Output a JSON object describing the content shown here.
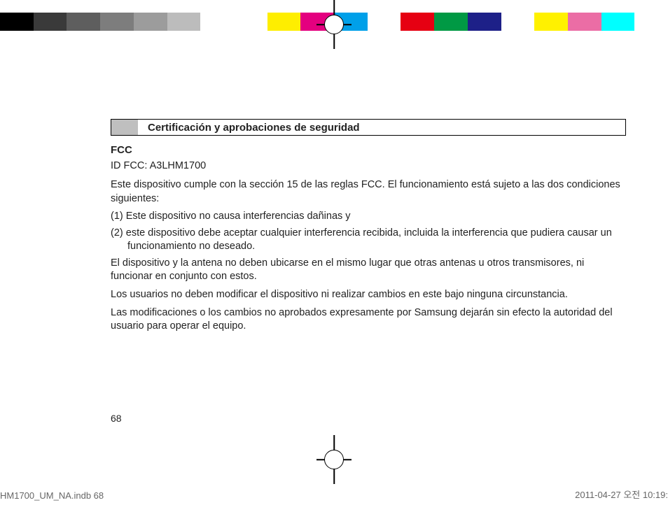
{
  "color_bar": [
    "#000000",
    "#3a3a3a",
    "#5e5e5e",
    "#7d7d7d",
    "#9c9c9c",
    "#bcbcbc",
    "#ffffff",
    "#ffffff",
    "#feee00",
    "#e4007f",
    "#00a0e9",
    "#ffffff",
    "#e60012",
    "#009944",
    "#1d2088",
    "#ffffff",
    "#fff100",
    "#eb6da5",
    "#00ffff",
    "#ffffff"
  ],
  "section_title": "Certificación y aprobaciones de seguridad",
  "fcc": {
    "heading": "FCC",
    "id_line": "ID FCC: A3LHM1700",
    "intro": "Este dispositivo cumple con la sección 15 de las reglas FCC. El funcionamiento está sujeto a las dos condiciones siguientes:",
    "item1": "(1) Este dispositivo no causa interferencias dañinas y",
    "item2": "(2) este dispositivo debe aceptar cualquier interferencia recibida, incluida la interferencia que pudiera causar un funcionamiento no deseado.",
    "para1": "El dispositivo y la antena no deben ubicarse en el mismo lugar que otras antenas u otros transmisores, ni funcionar en conjunto con estos.",
    "para2": "Los usuarios no deben modificar el dispositivo ni realizar cambios en este bajo ninguna circunstancia.",
    "para3": "Las modificaciones o los cambios no aprobados expresamente por Samsung dejarán sin efecto la autoridad del usuario para operar el equipo."
  },
  "page_number": "68",
  "footer": {
    "left": "HM1700_UM_NA.indb   68",
    "right": "2011-04-27   오전 10:19:"
  }
}
